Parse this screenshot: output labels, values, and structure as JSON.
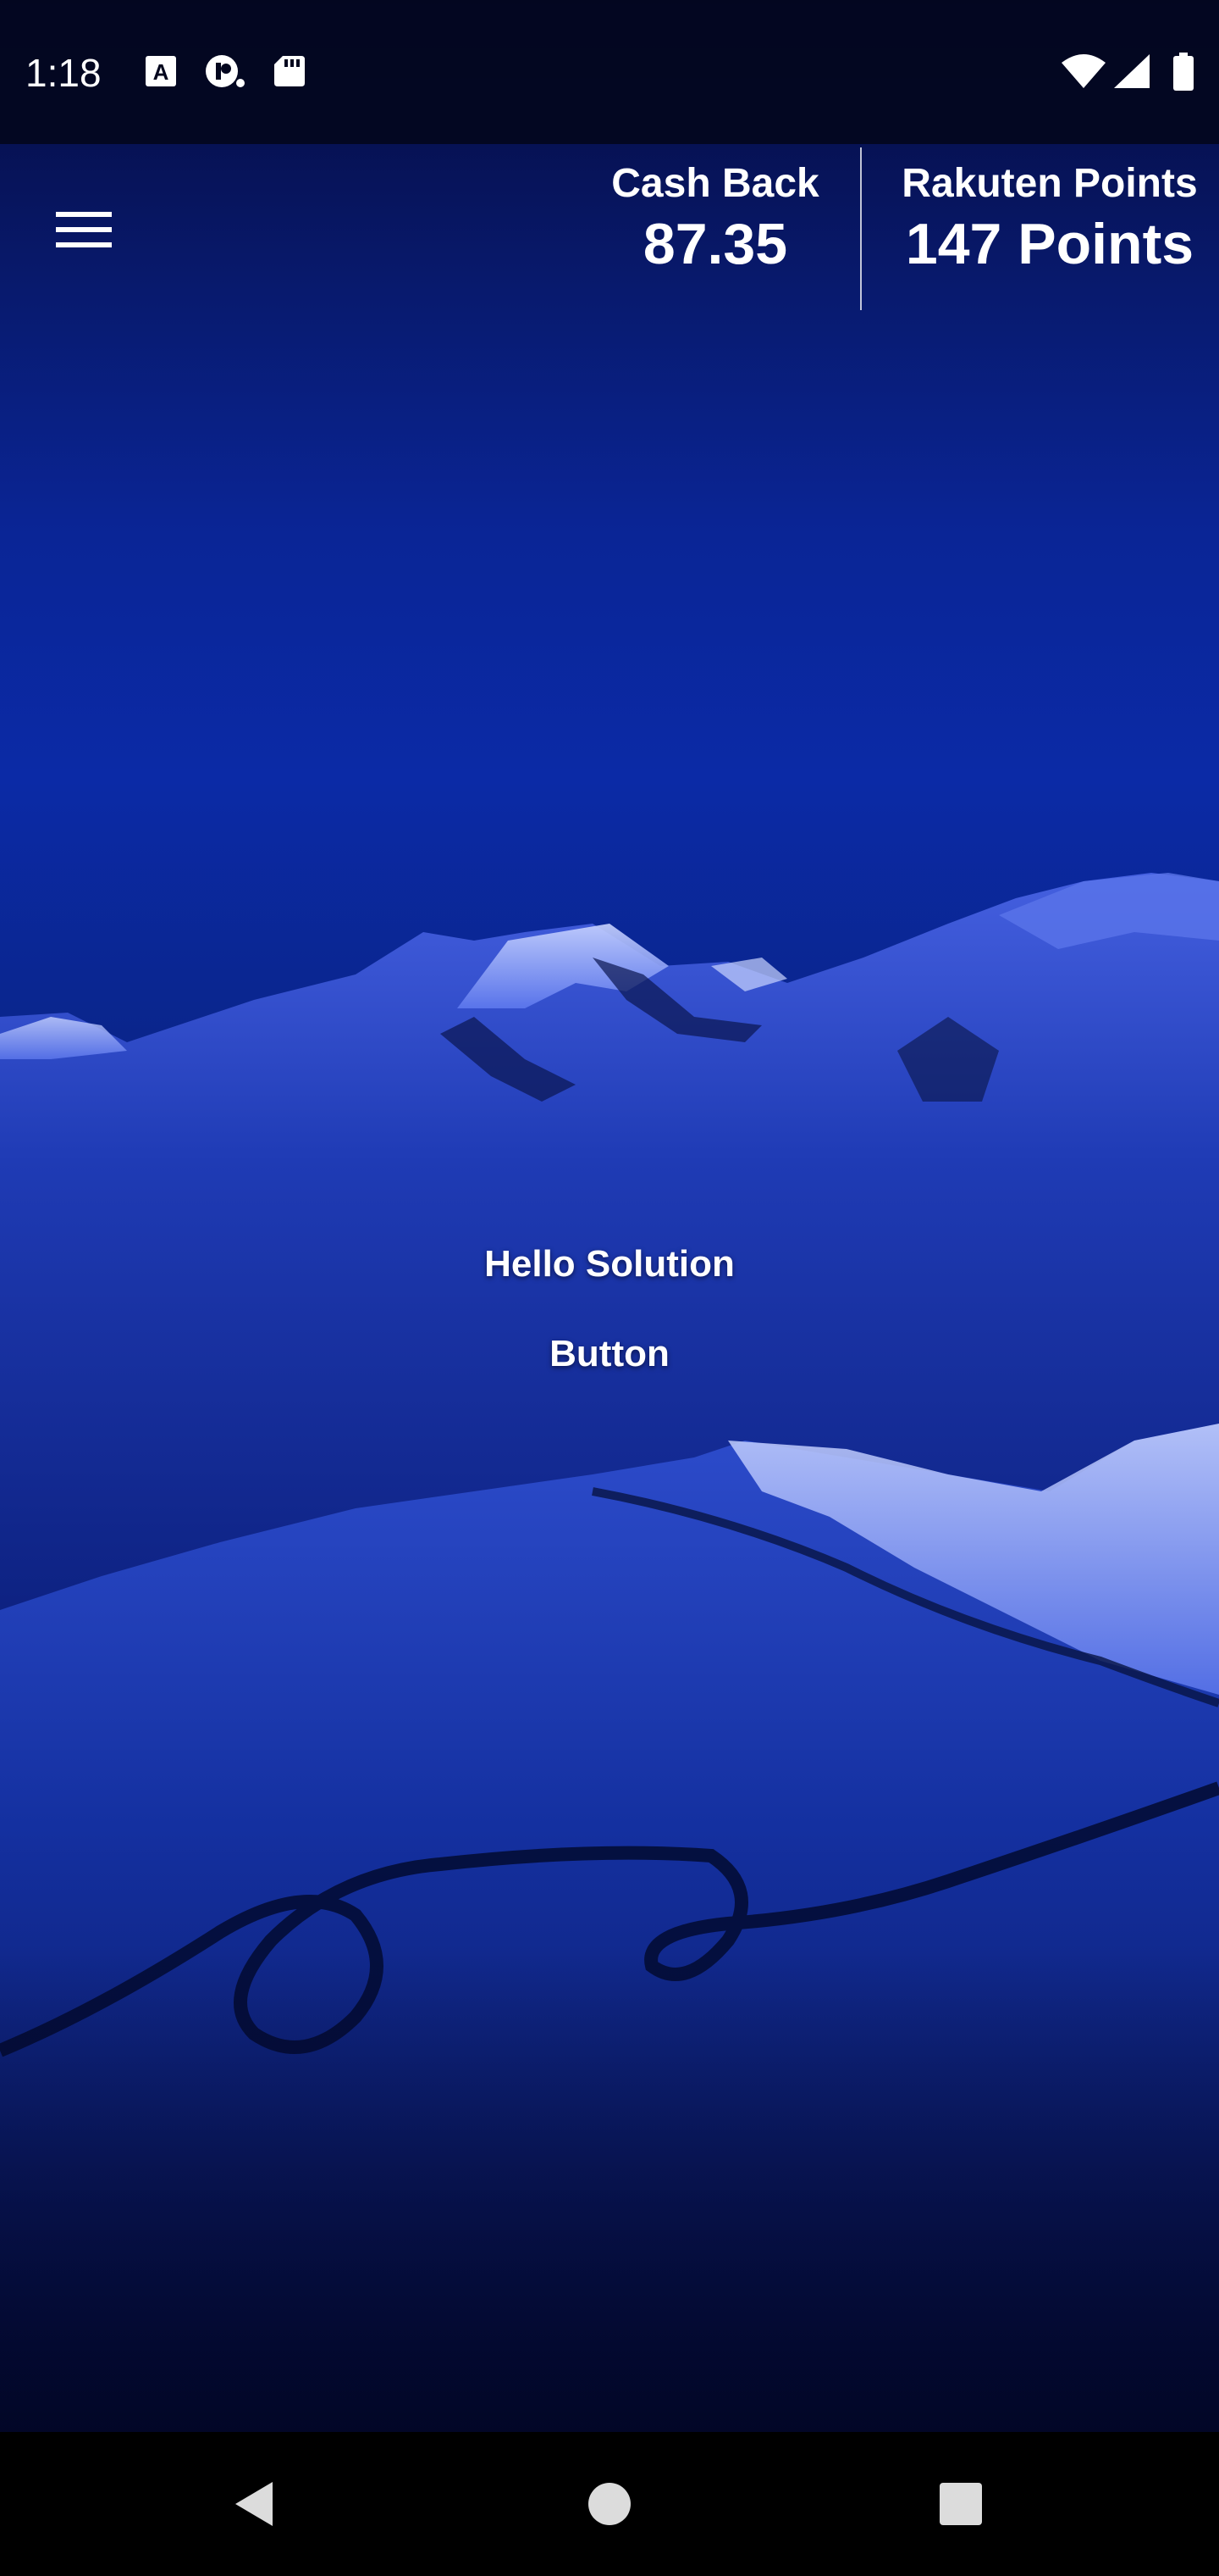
{
  "status_bar": {
    "time": "1:18",
    "left_icons": [
      "text-a-icon",
      "circle-p-icon",
      "sd-card-icon"
    ],
    "right_icons": [
      "wifi-icon",
      "cell-signal-icon",
      "battery-icon"
    ]
  },
  "header": {
    "menu_icon": "hamburger-menu-icon",
    "cash_back": {
      "label": "Cash Back",
      "value": "87.35"
    },
    "rakuten_points": {
      "label": "Rakuten Points",
      "value": "147 Points"
    }
  },
  "main": {
    "background": "night-snow-mountain-image",
    "greeting": "Hello Solution",
    "button_label": "Button"
  },
  "nav_bar": {
    "icons": [
      "back-triangle-icon",
      "home-circle-icon",
      "recents-square-icon"
    ]
  },
  "colors": {
    "sky_top": "#050a3c",
    "sky_mid": "#0b2aa6",
    "snow": "#8fa8ff",
    "text": "#ffffff",
    "nav_bar": "#000000"
  }
}
